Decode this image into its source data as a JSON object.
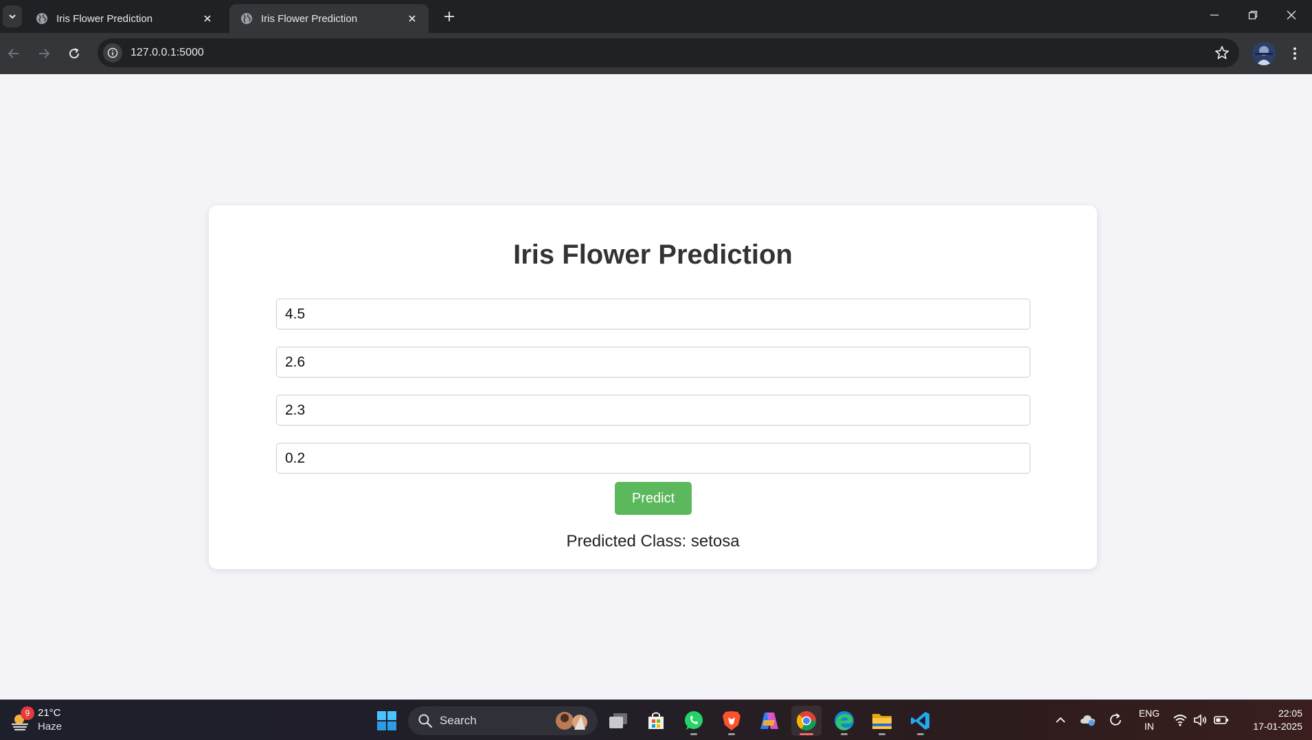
{
  "browser": {
    "tabs": [
      {
        "title": "Iris Flower Prediction",
        "active": false
      },
      {
        "title": "Iris Flower Prediction",
        "active": true
      }
    ],
    "url": "127.0.0.1:5000"
  },
  "page": {
    "heading": "Iris Flower Prediction",
    "inputs": [
      {
        "value": "4.5"
      },
      {
        "value": "2.6"
      },
      {
        "value": "2.3"
      },
      {
        "value": "0.2"
      }
    ],
    "predict_label": "Predict",
    "result_text": "Predicted Class: setosa"
  },
  "taskbar": {
    "weather": {
      "temp": "21°C",
      "desc": "Haze",
      "badge": "9"
    },
    "search_label": "Search",
    "language": {
      "line1": "ENG",
      "line2": "IN"
    },
    "clock": {
      "time": "22:05",
      "date": "17-01-2025"
    }
  },
  "colors": {
    "page_bg": "#f4f4f8",
    "card_bg": "#ffffff",
    "button_green": "#5cb85c",
    "heading": "#333333"
  }
}
